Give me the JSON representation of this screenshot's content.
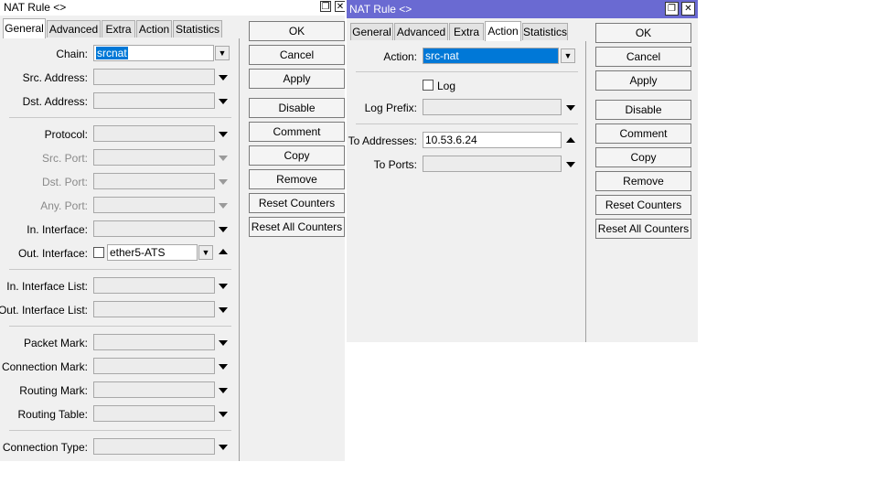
{
  "left_window": {
    "title": "NAT Rule <>",
    "tabs": [
      "General",
      "Advanced",
      "Extra",
      "Action",
      "Statistics"
    ],
    "active_tab": "General",
    "fields": {
      "chain": {
        "label": "Chain:",
        "value": "srcnat"
      },
      "src_address": {
        "label": "Src. Address:",
        "value": ""
      },
      "dst_address": {
        "label": "Dst. Address:",
        "value": ""
      },
      "protocol": {
        "label": "Protocol:",
        "value": ""
      },
      "src_port": {
        "label": "Src. Port:",
        "value": ""
      },
      "dst_port": {
        "label": "Dst. Port:",
        "value": ""
      },
      "any_port": {
        "label": "Any. Port:",
        "value": ""
      },
      "in_interface": {
        "label": "In. Interface:",
        "value": ""
      },
      "out_interface": {
        "label": "Out. Interface:",
        "value": "ether5-ATS"
      },
      "in_interface_list": {
        "label": "In. Interface List:",
        "value": ""
      },
      "out_interface_list": {
        "label": "Out. Interface List:",
        "value": ""
      },
      "packet_mark": {
        "label": "Packet Mark:",
        "value": ""
      },
      "connection_mark": {
        "label": "Connection Mark:",
        "value": ""
      },
      "routing_mark": {
        "label": "Routing Mark:",
        "value": ""
      },
      "routing_table": {
        "label": "Routing Table:",
        "value": ""
      },
      "connection_type": {
        "label": "Connection Type:",
        "value": ""
      }
    },
    "buttons": [
      "OK",
      "Cancel",
      "Apply",
      "Disable",
      "Comment",
      "Copy",
      "Remove",
      "Reset Counters",
      "Reset All Counters"
    ]
  },
  "right_window": {
    "title": "NAT Rule <>",
    "tabs": [
      "General",
      "Advanced",
      "Extra",
      "Action",
      "Statistics"
    ],
    "active_tab": "Action",
    "fields": {
      "action": {
        "label": "Action:",
        "value": "src-nat"
      },
      "log": {
        "label": "Log",
        "checked": false
      },
      "log_prefix": {
        "label": "Log Prefix:",
        "value": ""
      },
      "to_addresses": {
        "label": "To Addresses:",
        "value": "10.53.6.24"
      },
      "to_ports": {
        "label": "To Ports:",
        "value": ""
      }
    },
    "buttons": [
      "OK",
      "Cancel",
      "Apply",
      "Disable",
      "Comment",
      "Copy",
      "Remove",
      "Reset Counters",
      "Reset All Counters"
    ]
  },
  "colors": {
    "selection": "#0078d7",
    "titlebar_active": "#6a6ad2"
  }
}
